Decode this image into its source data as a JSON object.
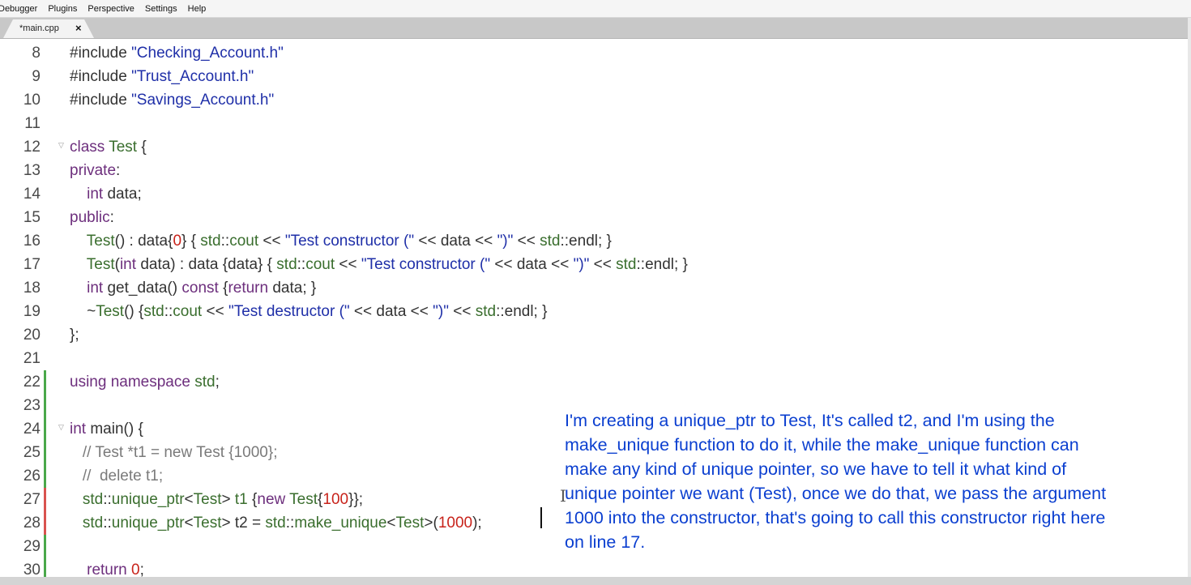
{
  "menu": [
    "Debugger",
    "Plugins",
    "Perspective",
    "Settings",
    "Help"
  ],
  "tab": {
    "label": "*main.cpp",
    "close": "×"
  },
  "code_lines": [
    {
      "n": "8",
      "tokens": [
        [
          "pre",
          "#include "
        ],
        [
          "str",
          "\"Checking_Account.h\""
        ]
      ]
    },
    {
      "n": "9",
      "tokens": [
        [
          "pre",
          "#include "
        ],
        [
          "str",
          "\"Trust_Account.h\""
        ]
      ]
    },
    {
      "n": "10",
      "tokens": [
        [
          "pre",
          "#include "
        ],
        [
          "str",
          "\"Savings_Account.h\""
        ]
      ]
    },
    {
      "n": "11",
      "tokens": []
    },
    {
      "n": "12",
      "fold": true,
      "tokens": [
        [
          "kw",
          "class "
        ],
        [
          "ty",
          "Test"
        ],
        [
          "op",
          " {"
        ]
      ]
    },
    {
      "n": "13",
      "tokens": [
        [
          "kw",
          "private"
        ],
        [
          "op",
          ":"
        ]
      ]
    },
    {
      "n": "14",
      "tokens": [
        [
          "kw",
          "    int "
        ],
        [
          "op",
          "data;"
        ]
      ]
    },
    {
      "n": "15",
      "tokens": [
        [
          "kw",
          "public"
        ],
        [
          "op",
          ":"
        ]
      ]
    },
    {
      "n": "16",
      "tokens": [
        [
          "ty",
          "    Test"
        ],
        [
          "op",
          "() : data{"
        ],
        [
          "num",
          "0"
        ],
        [
          "op",
          "} { "
        ],
        [
          "ty",
          "std"
        ],
        [
          "op",
          "::"
        ],
        [
          "ty",
          "cout"
        ],
        [
          "op",
          " << "
        ],
        [
          "str",
          "\"Test constructor (\""
        ],
        [
          "op",
          " << data << "
        ],
        [
          "str",
          "\")\""
        ],
        [
          "op",
          " << "
        ],
        [
          "ty",
          "std"
        ],
        [
          "op",
          "::endl; }"
        ]
      ]
    },
    {
      "n": "17",
      "tokens": [
        [
          "ty",
          "    Test"
        ],
        [
          "op",
          "("
        ],
        [
          "kw",
          "int "
        ],
        [
          "op",
          "data) : data {data} { "
        ],
        [
          "ty",
          "std"
        ],
        [
          "op",
          "::"
        ],
        [
          "ty",
          "cout"
        ],
        [
          "op",
          " << "
        ],
        [
          "str",
          "\"Test constructor (\""
        ],
        [
          "op",
          " << data << "
        ],
        [
          "str",
          "\")\""
        ],
        [
          "op",
          " << "
        ],
        [
          "ty",
          "std"
        ],
        [
          "op",
          "::endl; }"
        ]
      ]
    },
    {
      "n": "18",
      "tokens": [
        [
          "kw",
          "    int "
        ],
        [
          "op",
          "get_data() "
        ],
        [
          "kw",
          "const "
        ],
        [
          "op",
          "{"
        ],
        [
          "kw",
          "return "
        ],
        [
          "op",
          "data; }"
        ]
      ]
    },
    {
      "n": "19",
      "tokens": [
        [
          "op",
          "    ~"
        ],
        [
          "ty",
          "Test"
        ],
        [
          "op",
          "() {"
        ],
        [
          "ty",
          "std"
        ],
        [
          "op",
          "::"
        ],
        [
          "ty",
          "cout"
        ],
        [
          "op",
          " << "
        ],
        [
          "str",
          "\"Test destructor (\""
        ],
        [
          "op",
          " << data << "
        ],
        [
          "str",
          "\")\""
        ],
        [
          "op",
          " << "
        ],
        [
          "ty",
          "std"
        ],
        [
          "op",
          "::endl; }"
        ]
      ]
    },
    {
      "n": "20",
      "tokens": [
        [
          "op",
          "};"
        ]
      ]
    },
    {
      "n": "21",
      "tokens": []
    },
    {
      "n": "22",
      "change": "#4aa84a",
      "tokens": [
        [
          "kw",
          "using namespace "
        ],
        [
          "ty",
          "std"
        ],
        [
          "op",
          ";"
        ]
      ]
    },
    {
      "n": "23",
      "change": "#4aa84a",
      "tokens": []
    },
    {
      "n": "24",
      "change": "#4aa84a",
      "fold": true,
      "tokens": [
        [
          "kw",
          "int "
        ],
        [
          "op",
          "main() {"
        ]
      ]
    },
    {
      "n": "25",
      "change": "#4aa84a",
      "tokens": [
        [
          "cm",
          "   // Test *t1 = new Test {1000};"
        ]
      ]
    },
    {
      "n": "26",
      "change": "#4aa84a",
      "tokens": [
        [
          "cm",
          "   //  delete t1;"
        ]
      ]
    },
    {
      "n": "27",
      "change": "#d9534f",
      "tokens": [
        [
          "ty",
          "   std"
        ],
        [
          "op",
          "::"
        ],
        [
          "ty",
          "unique_ptr"
        ],
        [
          "op",
          "<"
        ],
        [
          "ty",
          "Test"
        ],
        [
          "op",
          "> "
        ],
        [
          "ty",
          "t1"
        ],
        [
          "op",
          " {"
        ],
        [
          "kw",
          "new "
        ],
        [
          "ty",
          "Test"
        ],
        [
          "op",
          "{"
        ],
        [
          "num",
          "100"
        ],
        [
          "op",
          "}};"
        ]
      ]
    },
    {
      "n": "28",
      "change": "#d9534f",
      "tokens": [
        [
          "ty",
          "   std"
        ],
        [
          "op",
          "::"
        ],
        [
          "ty",
          "unique_ptr"
        ],
        [
          "op",
          "<"
        ],
        [
          "ty",
          "Test"
        ],
        [
          "op",
          "> t2 = "
        ],
        [
          "ty",
          "std"
        ],
        [
          "op",
          "::"
        ],
        [
          "ty",
          "make_unique"
        ],
        [
          "op",
          "<"
        ],
        [
          "ty",
          "Test"
        ],
        [
          "op",
          ">("
        ],
        [
          "num",
          "1000"
        ],
        [
          "op",
          ");"
        ]
      ]
    },
    {
      "n": "29",
      "change": "#4aa84a",
      "tokens": []
    },
    {
      "n": "30",
      "change": "#4aa84a",
      "tokens": [
        [
          "kw",
          "    return "
        ],
        [
          "num",
          "0"
        ],
        [
          "op",
          ";"
        ]
      ]
    }
  ],
  "annotation": [
    "I'm creating a unique_ptr to Test, It's called t2, and I'm using the",
    "make_unique function to do it, while the make_unique function can",
    "make any kind of unique pointer, so we have to tell it what kind of",
    "unique pointer we want (Test), once we do that, we pass the argument",
    "1000 into the constructor, that's going to call this constructor right here",
    "on line 17."
  ],
  "colors": {
    "string": "#1f2fa8",
    "keyword": "#6d2f7d",
    "type": "#3a6e2e",
    "number": "#c8231b",
    "comment": "#7a7a7a",
    "annotation": "#0b3fd0"
  }
}
